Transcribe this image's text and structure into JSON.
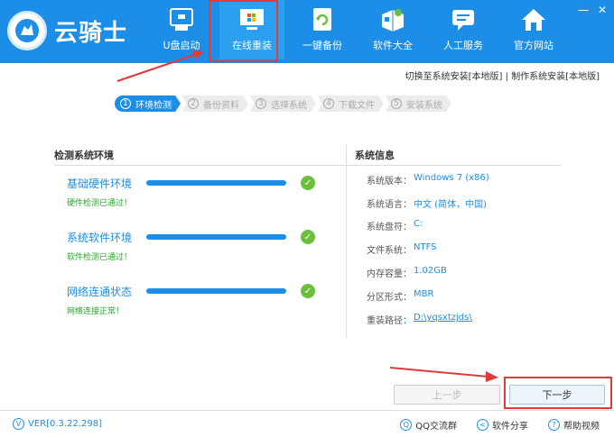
{
  "app": {
    "logo_text": "云骑士",
    "window_controls": [
      "—",
      "✕"
    ]
  },
  "nav": {
    "items": [
      {
        "label": "U盘启动",
        "icon": "usb-drive-icon"
      },
      {
        "label": "在线重装",
        "icon": "windows-monitor-icon"
      },
      {
        "label": "一键备份",
        "icon": "backup-refresh-icon"
      },
      {
        "label": "软件大全",
        "icon": "software-box-icon"
      },
      {
        "label": "人工服务",
        "icon": "chat-service-icon"
      },
      {
        "label": "官方网站",
        "icon": "home-icon"
      }
    ],
    "active_index": 1
  },
  "top_links": {
    "link1": "切换至系统安装[本地版]",
    "separator": " | ",
    "link2": "制作系统安装[本地版]"
  },
  "steps": [
    {
      "num": "1",
      "label": "环境检测"
    },
    {
      "num": "2",
      "label": "备份资料"
    },
    {
      "num": "3",
      "label": "选择系统"
    },
    {
      "num": "4",
      "label": "下载文件"
    },
    {
      "num": "5",
      "label": "安装系统"
    }
  ],
  "left_panel": {
    "title": "检测系统环境",
    "checks": [
      {
        "title": "基础硬件环境",
        "status": "硬件检测已通过！"
      },
      {
        "title": "系统软件环境",
        "status": "软件检测已通过！"
      },
      {
        "title": "网络连通状态",
        "status": "网络连接正常！"
      }
    ]
  },
  "right_panel": {
    "title": "系统信息",
    "rows": [
      {
        "label": "系统版本：",
        "value": "Windows 7 (x86)"
      },
      {
        "label": "系统语言：",
        "value": "中文 (简体，中国)"
      },
      {
        "label": "系统盘符：",
        "value": "C:"
      },
      {
        "label": "文件系统：",
        "value": "NTFS"
      },
      {
        "label": "内存容量：",
        "value": "1.02GB"
      },
      {
        "label": "分区形式：",
        "value": "MBR"
      },
      {
        "label": "重装路径：",
        "value": "D:\\yqsxtzjds\\"
      }
    ]
  },
  "buttons": {
    "prev": "上一步",
    "next": "下一步"
  },
  "footer": {
    "version": "VER[0.3.22.298]",
    "qq": "QQ交流群",
    "share": "软件分享",
    "help": "帮助视频"
  },
  "colors": {
    "brand_blue": "#1c8ee8",
    "success_green": "#6cbf3a",
    "highlight_red": "#e03a3a"
  }
}
